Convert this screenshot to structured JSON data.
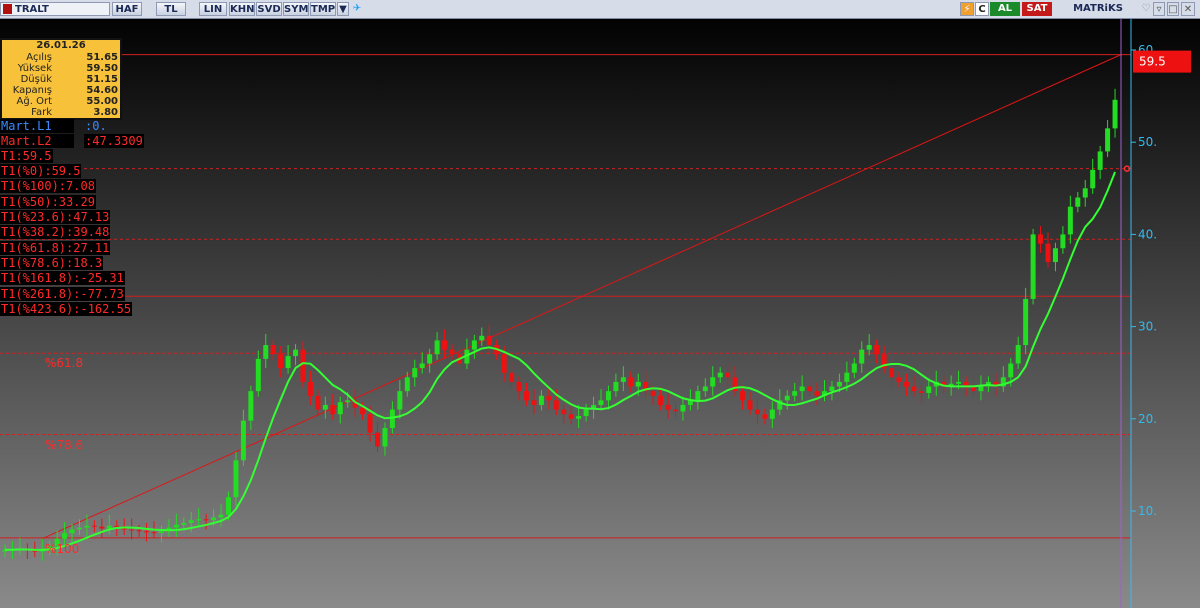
{
  "toolbar": {
    "symbol": "TRALT",
    "buttons": [
      "HAF",
      "TL",
      "LIN",
      "KHN",
      "SVD",
      "SYM",
      "TMP"
    ],
    "buy": "AL",
    "sell": "SAT",
    "brand": "MATRiKS"
  },
  "panel": {
    "date": "26.01.26",
    "rows": [
      {
        "label": "Açılış",
        "value": "51.65"
      },
      {
        "label": "Yüksek",
        "value": "59.50"
      },
      {
        "label": "Düşük",
        "value": "51.15"
      },
      {
        "label": "Kapanış",
        "value": "54.60"
      },
      {
        "label": "Ağ. Ort",
        "value": "55.00"
      },
      {
        "label": "Fark",
        "value": "3.80"
      }
    ]
  },
  "indicators": {
    "mart_l1": {
      "label": "Mart.L1",
      "value": ":0."
    },
    "mart_l2": {
      "label": "Mart.L2",
      "value": ":47.3309"
    }
  },
  "fib_labels": [
    "T1:59.5",
    "T1(%0):59.5",
    "T1(%100):7.08",
    "T1(%50):33.29",
    "T1(%23.6):47.13",
    "T1(%38.2):39.48",
    "T1(%61.8):27.11",
    "T1(%78.6):18.3",
    "T1(%161.8):-25.31",
    "T1(%261.8):-77.73",
    "T1(%423.6):-162.55"
  ],
  "chart_labels": {
    "pct618": "%61.8",
    "pct786": "%78.6",
    "pct100": "%100"
  },
  "price_tag": "59.5",
  "colors": {
    "up": "#22dd22",
    "down": "#ee1111",
    "ma": "#33ff33",
    "grid": "#cc2020",
    "axis": "#33bbee"
  },
  "chart_data": {
    "type": "candlestick",
    "ylim": [
      4,
      62
    ],
    "y_ticks": [
      {
        "v": 60,
        "t": "60."
      },
      {
        "v": 50,
        "t": "50."
      },
      {
        "v": 40,
        "t": "40."
      },
      {
        "v": 30,
        "t": "30."
      },
      {
        "v": 20,
        "t": "20."
      },
      {
        "v": 10,
        "t": "10."
      }
    ],
    "fib_levels": [
      {
        "name": "%0",
        "value": 59.5,
        "style": "solid"
      },
      {
        "name": "%23.6",
        "value": 47.13,
        "style": "dash"
      },
      {
        "name": "%38.2",
        "value": 39.48,
        "style": "dash"
      },
      {
        "name": "%50",
        "value": 33.29,
        "style": "solid"
      },
      {
        "name": "%61.8",
        "value": 27.11,
        "style": "dash"
      },
      {
        "name": "%78.6",
        "value": 18.3,
        "style": "dash"
      },
      {
        "name": "%100",
        "value": 7.08,
        "style": "solid"
      }
    ],
    "trend_line": {
      "from": [
        5,
        7.0
      ],
      "to": [
        149,
        59.5
      ]
    },
    "closes": [
      5.8,
      5.8,
      5.9,
      5.8,
      5.6,
      5.8,
      6.2,
      7.0,
      7.6,
      8.0,
      8.2,
      8.4,
      8.3,
      8.1,
      8.4,
      8.3,
      8.0,
      7.9,
      7.8,
      7.7,
      7.6,
      7.8,
      8.2,
      8.5,
      8.7,
      9.0,
      9.1,
      9.0,
      9.3,
      9.6,
      11.5,
      15.5,
      19.8,
      23.0,
      26.5,
      28.0,
      27.0,
      25.5,
      26.8,
      27.5,
      24.0,
      22.5,
      21.0,
      21.5,
      20.5,
      21.8,
      22.0,
      21.2,
      20.5,
      18.5,
      17.0,
      19.0,
      21.0,
      23.0,
      24.5,
      25.5,
      26.0,
      27.0,
      28.5,
      27.5,
      27.0,
      26.0,
      27.5,
      28.5,
      29.0,
      28.0,
      27.0,
      25.0,
      24.0,
      23.0,
      22.0,
      21.5,
      22.5,
      22.0,
      21.0,
      20.5,
      20.0,
      20.3,
      21.0,
      21.5,
      22.0,
      23.0,
      24.0,
      24.5,
      23.5,
      24.0,
      23.0,
      22.5,
      21.5,
      21.0,
      20.8,
      21.5,
      22.0,
      23.0,
      23.5,
      24.5,
      25.0,
      24.5,
      23.0,
      22.0,
      21.0,
      20.5,
      20.0,
      21.0,
      22.0,
      22.5,
      23.0,
      23.5,
      23.0,
      22.5,
      23.0,
      23.5,
      24.0,
      25.0,
      26.0,
      27.5,
      28.0,
      27.0,
      25.5,
      24.5,
      24.0,
      23.5,
      23.0,
      22.8,
      23.5,
      24.0,
      23.5,
      23.8,
      24.0,
      23.5,
      23.0,
      23.5,
      24.0,
      23.5,
      24.5,
      26.0,
      28.0,
      33.0,
      40.0,
      39.0,
      37.0,
      38.5,
      40.0,
      43.0,
      44.0,
      45.0,
      47.0,
      49.0,
      51.5,
      54.6
    ],
    "last_close": 54.6,
    "period_high": 59.5
  }
}
